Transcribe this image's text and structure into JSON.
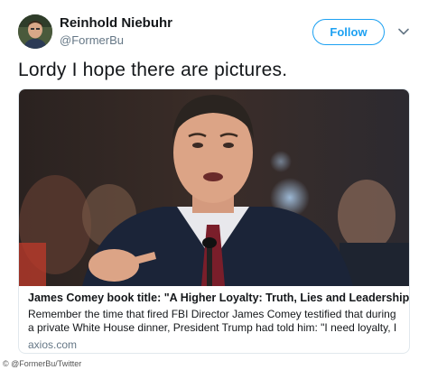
{
  "author": {
    "name": "Reinhold Niebuhr",
    "handle": "@FormerBu"
  },
  "follow_label": "Follow",
  "tweet_text": "Lordy I hope there are pictures.",
  "link_card": {
    "title": "James Comey book title: \"A Higher Loyalty: Truth, Lies and Leadership\"",
    "description": "Remember the time that fired FBI Director James Comey testified that during a private White House dinner, President Trump had told him: \"I need loyalty, I expect",
    "domain": "axios.com"
  },
  "credit": "© @FormerBu/Twitter",
  "colors": {
    "accent": "#1da1f2",
    "text": "#14171a",
    "muted": "#657786"
  },
  "icons": [
    "avatar",
    "chevron-down-icon"
  ]
}
